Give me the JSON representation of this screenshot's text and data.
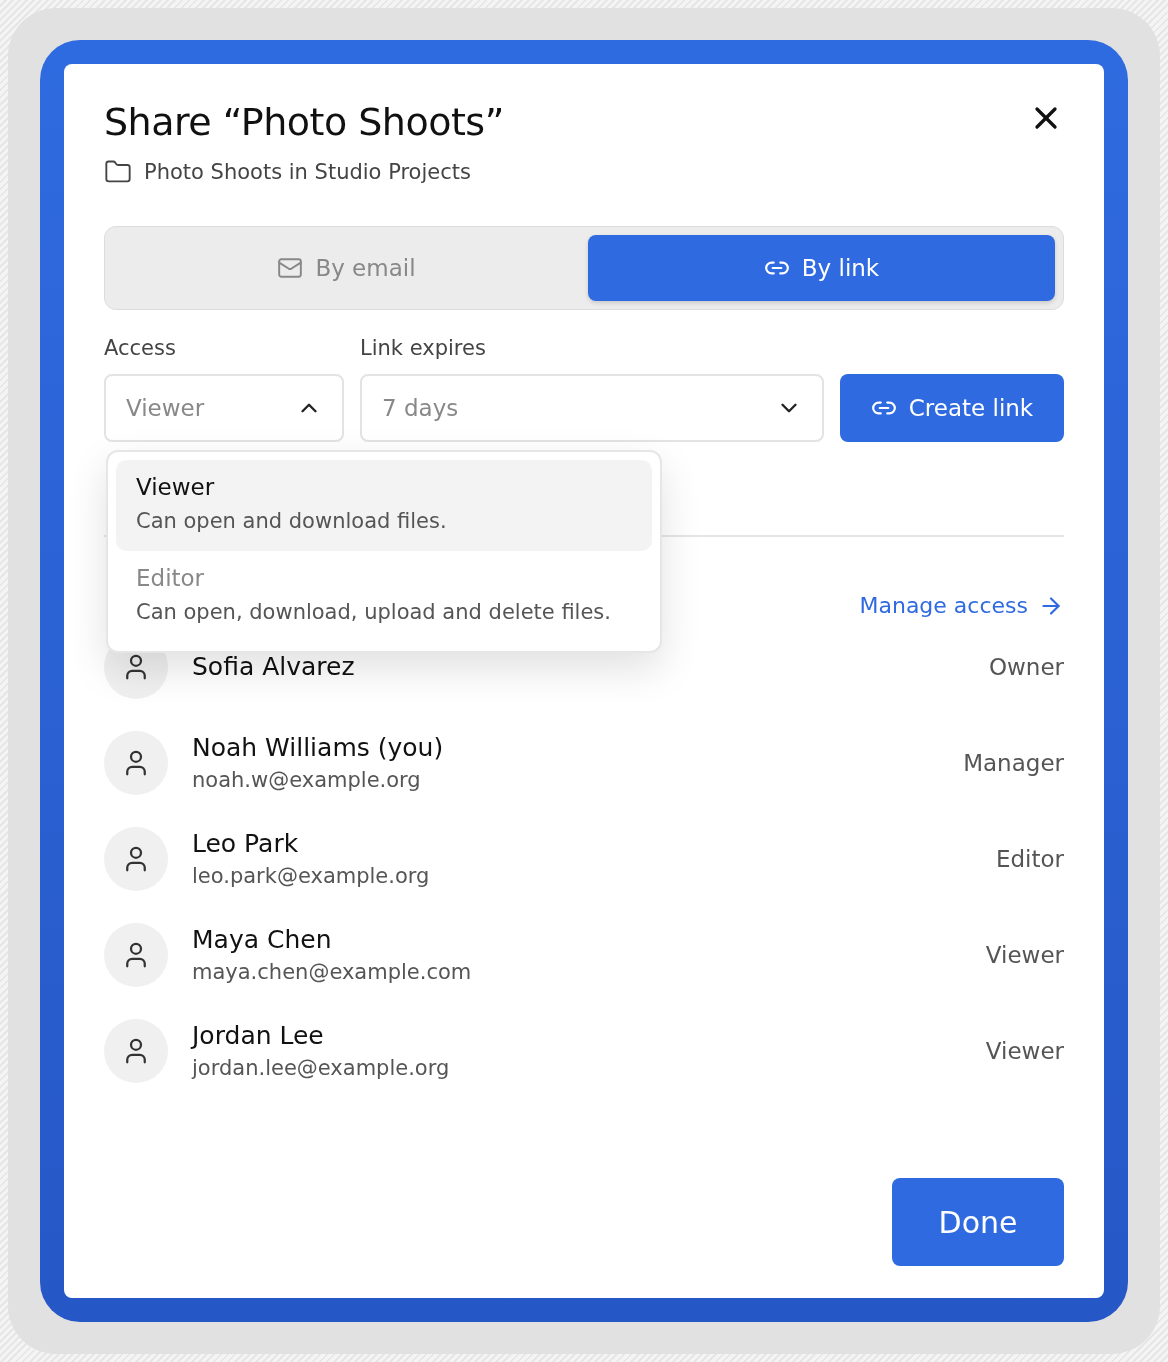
{
  "dialog": {
    "title": "Share “Photo Shoots”",
    "location": "Photo Shoots in Studio Projects"
  },
  "tabs": [
    {
      "label": "By email",
      "kind": "mail",
      "selected": false
    },
    {
      "label": "By link",
      "kind": "link",
      "selected": true
    }
  ],
  "access": {
    "label": "Access",
    "value": "Viewer",
    "expanded": true,
    "options": [
      {
        "title": "Viewer",
        "description": "Can open and download files.",
        "selected": true
      },
      {
        "title": "Editor",
        "description": "Can open, download, upload and delete files.",
        "selected": false
      }
    ]
  },
  "expiry": {
    "label": "Link expires",
    "value": "7 days",
    "expanded": false
  },
  "create_button": "Create link",
  "manage_link": "Manage access",
  "people": [
    {
      "name": "Sofia Alvarez",
      "role": "Owner"
    },
    {
      "name": "Noah Williams (you)",
      "email": "noah.w@example.org",
      "role": "Manager"
    },
    {
      "name": "Leo Park",
      "email": "leo.park@example.org",
      "role": "Editor"
    },
    {
      "name": "Maya Chen",
      "email": "maya.chen@example.com",
      "role": "Viewer"
    },
    {
      "name": "Jordan Lee",
      "email": "jordan.lee@example.org",
      "role": "Viewer"
    }
  ],
  "done_button": "Done"
}
